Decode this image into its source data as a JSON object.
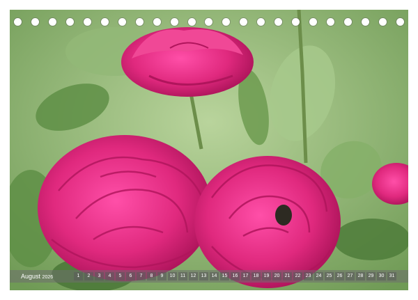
{
  "calendar": {
    "month_label": "August",
    "year_label": "2026",
    "days": [
      "1",
      "2",
      "3",
      "4",
      "5",
      "6",
      "7",
      "8",
      "9",
      "10",
      "11",
      "12",
      "13",
      "14",
      "15",
      "16",
      "17",
      "18",
      "19",
      "20",
      "21",
      "22",
      "23",
      "24",
      "25",
      "26",
      "27",
      "28",
      "29",
      "30",
      "31"
    ]
  },
  "colors": {
    "rose": "#e0297e",
    "rose_dark": "#b0155c",
    "leaf": "#5f8f46",
    "background_green": "#9bbf7e"
  },
  "icons": [
    "binder-hole-icon"
  ]
}
